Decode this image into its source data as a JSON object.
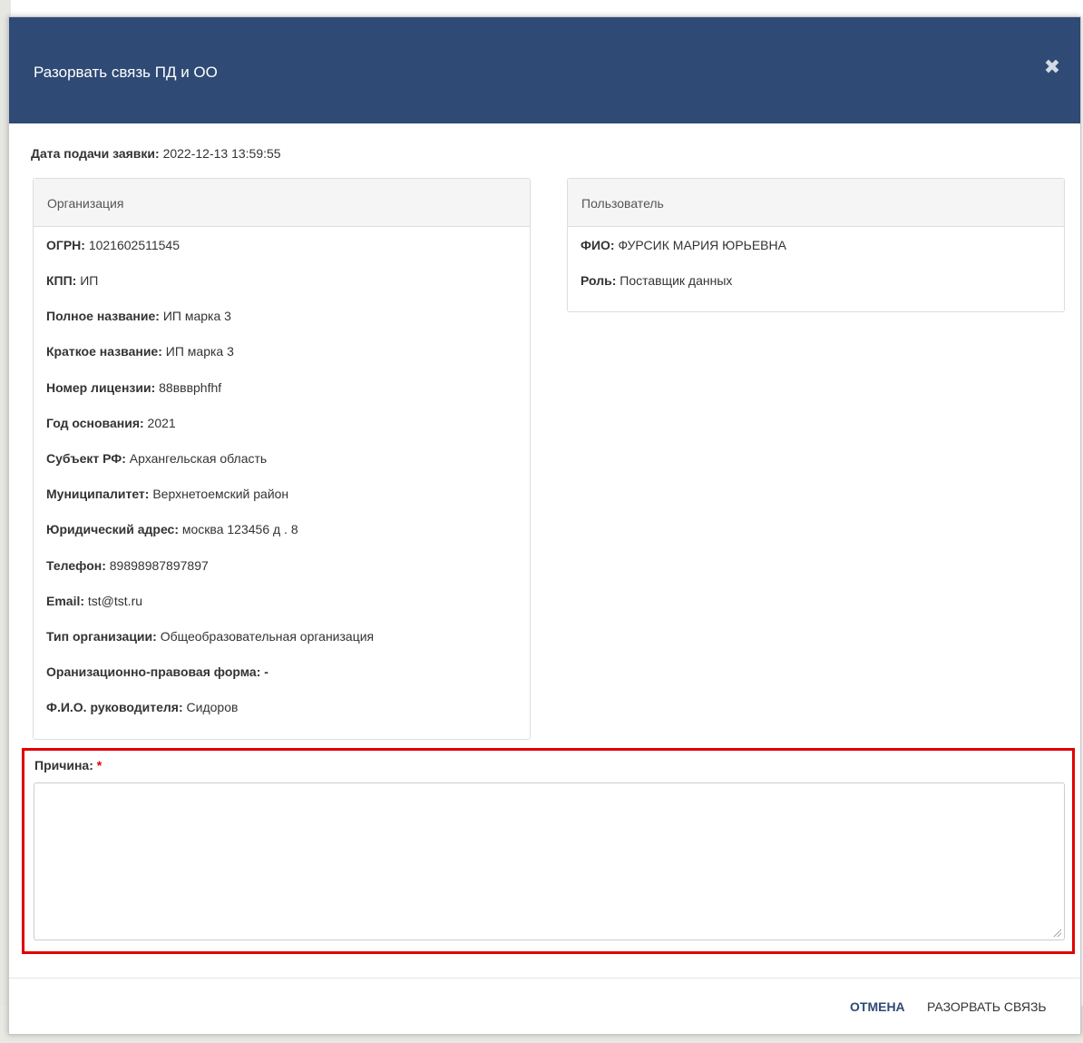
{
  "modal": {
    "title": "Разорвать связь ПД и ОО",
    "close_icon": "close-icon"
  },
  "date": {
    "label": "Дата подачи заявки:",
    "value": "2022-12-13 13:59:55"
  },
  "organization": {
    "heading": "Организация",
    "fields": [
      {
        "label": "ОГРН:",
        "value": "1021602511545"
      },
      {
        "label": "КПП:",
        "value": "ИП"
      },
      {
        "label": "Полное название:",
        "value": "ИП марка 3"
      },
      {
        "label": "Краткое название:",
        "value": "ИП марка 3"
      },
      {
        "label": "Номер лицензии:",
        "value": "88вввphfhf"
      },
      {
        "label": "Год основания:",
        "value": "2021"
      },
      {
        "label": "Субъект РФ:",
        "value": "Архангельская область"
      },
      {
        "label": "Муниципалитет:",
        "value": "Верхнетоемский район"
      },
      {
        "label": "Юридический адрес:",
        "value": "москва 123456 д . 8"
      },
      {
        "label": "Телефон:",
        "value": "89898987897897"
      },
      {
        "label": "Email:",
        "value": "tst@tst.ru"
      },
      {
        "label": "Тип организации:",
        "value": "Общеобразовательная организация"
      },
      {
        "label": "Оранизационно-правовая форма:",
        "value": "-"
      },
      {
        "label": "Ф.И.О. руководителя:",
        "value": "Сидоров"
      }
    ]
  },
  "user": {
    "heading": "Пользователь",
    "fields": [
      {
        "label": "ФИО:",
        "value": "ФУРСИК МАРИЯ ЮРЬЕВНА"
      },
      {
        "label": "Роль:",
        "value": "Поставщик данных"
      }
    ]
  },
  "reason": {
    "label": "Причина:",
    "required_mark": "*",
    "value": ""
  },
  "footer": {
    "cancel_label": "ОТМЕНА",
    "break_label": "РАЗОРВАТЬ СВЯЗЬ"
  },
  "colors": {
    "header": "#2e4a75",
    "highlight_frame": "#e00000"
  }
}
